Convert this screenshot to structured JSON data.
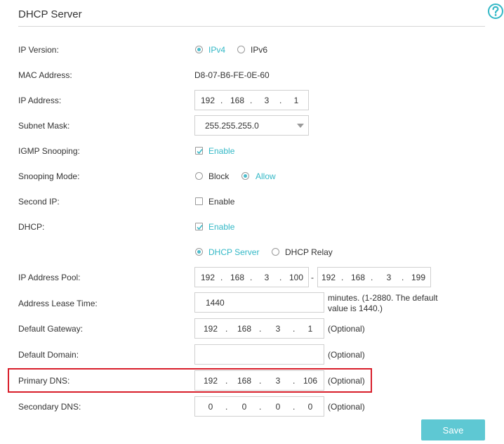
{
  "header": {
    "title": "DHCP Server"
  },
  "fields": {
    "ip_version": {
      "label": "IP Version:",
      "options": [
        "IPv4",
        "IPv6"
      ],
      "selected": "IPv4"
    },
    "mac_address": {
      "label": "MAC Address:",
      "value": "D8-07-B6-FE-0E-60"
    },
    "ip_address": {
      "label": "IP Address:",
      "octets": [
        "192",
        "168",
        "3",
        "1"
      ]
    },
    "subnet_mask": {
      "label": "Subnet Mask:",
      "value": "255.255.255.0"
    },
    "igmp_snooping": {
      "label": "IGMP Snooping:",
      "checkbox_label": "Enable",
      "checked": true
    },
    "snooping_mode": {
      "label": "Snooping Mode:",
      "options": [
        "Block",
        "Allow"
      ],
      "selected": "Allow"
    },
    "second_ip": {
      "label": "Second IP:",
      "checkbox_label": "Enable",
      "checked": false
    },
    "dhcp": {
      "label": "DHCP:",
      "checkbox_label": "Enable",
      "checked": true,
      "modes": [
        "DHCP Server",
        "DHCP Relay"
      ],
      "selected_mode": "DHCP Server"
    },
    "ip_pool": {
      "label": "IP Address Pool:",
      "start": [
        "192",
        "168",
        "3",
        "100"
      ],
      "end": [
        "192",
        "168",
        "3",
        "199"
      ],
      "separator": "-"
    },
    "lease_time": {
      "label": "Address Lease Time:",
      "value": "1440",
      "note_line1": "minutes. (1-2880. The default",
      "note_line2": "value is 1440.)"
    },
    "default_gateway": {
      "label": "Default Gateway:",
      "octets": [
        "192",
        "168",
        "3",
        "1"
      ],
      "hint": "(Optional)"
    },
    "default_domain": {
      "label": "Default Domain:",
      "value": "",
      "hint": "(Optional)"
    },
    "primary_dns": {
      "label": "Primary DNS:",
      "octets": [
        "192",
        "168",
        "3",
        "106"
      ],
      "hint": "(Optional)"
    },
    "secondary_dns": {
      "label": "Secondary DNS:",
      "octets": [
        "0",
        "0",
        "0",
        "0"
      ],
      "hint": "(Optional)"
    }
  },
  "actions": {
    "save_label": "Save"
  },
  "colors": {
    "accent": "#33b8c6",
    "button": "#5ec8d3",
    "highlight": "#d81e2a"
  },
  "icons": {
    "help": "question-circle-icon"
  }
}
